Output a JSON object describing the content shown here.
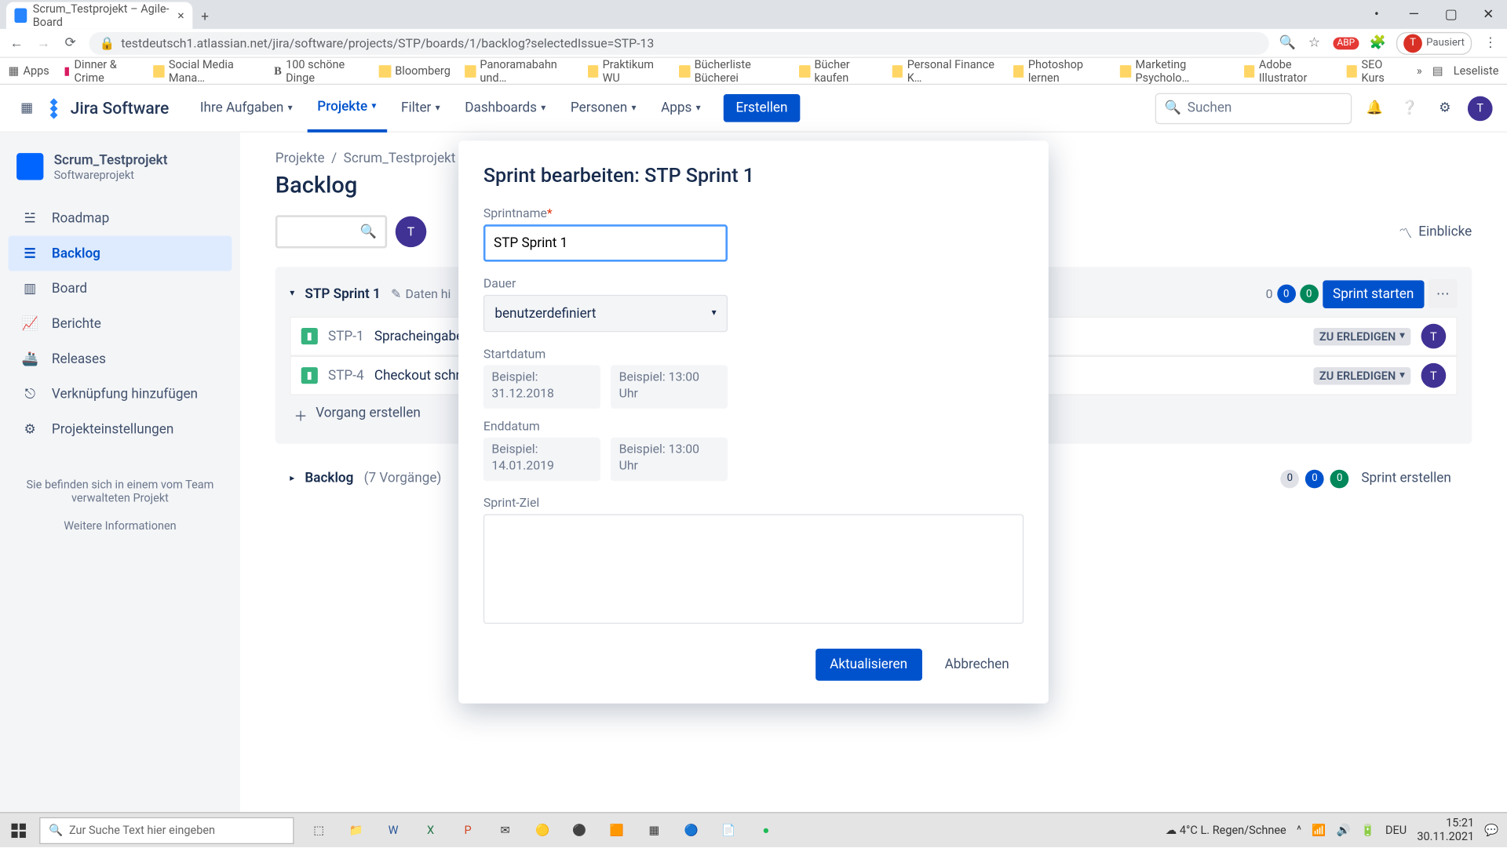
{
  "browser": {
    "tab_title": "Scrum_Testprojekt – Agile-Board",
    "url": "testdeutsch1.atlassian.net/jira/software/projects/STP/boards/1/backlog?selectedIssue=STP-13",
    "paused": "Pausiert",
    "bookmarks": [
      "Apps",
      "Dinner & Crime",
      "Social Media Mana…",
      "100 schöne Dinge",
      "Bloomberg",
      "Panoramabahn und…",
      "Praktikum WU",
      "Bücherliste Bücherei",
      "Bücher kaufen",
      "Personal Finance K…",
      "Photoshop lernen",
      "Marketing Psycholo…",
      "Adobe Illustrator",
      "SEO Kurs"
    ],
    "readlist": "Leseliste"
  },
  "nav": {
    "product": "Jira Software",
    "items": [
      "Ihre Aufgaben",
      "Projekte",
      "Filter",
      "Dashboards",
      "Personen",
      "Apps"
    ],
    "active": 1,
    "create": "Erstellen",
    "search_placeholder": "Suchen"
  },
  "sidebar": {
    "project_name": "Scrum_Testprojekt",
    "project_type": "Softwareprojekt",
    "items": [
      {
        "label": "Roadmap",
        "icon": "roadmap"
      },
      {
        "label": "Backlog",
        "icon": "backlog",
        "active": true
      },
      {
        "label": "Board",
        "icon": "board"
      },
      {
        "label": "Berichte",
        "icon": "reports"
      },
      {
        "label": "Releases",
        "icon": "releases"
      },
      {
        "label": "Verknüpfung hinzufügen",
        "icon": "link"
      },
      {
        "label": "Projekteinstellungen",
        "icon": "settings"
      }
    ],
    "footer1": "Sie befinden sich in einem vom Team verwalteten Projekt",
    "footer2": "Weitere Informationen"
  },
  "page": {
    "crumb_projects": "Projekte",
    "crumb_project": "Scrum_Testprojekt",
    "title": "Backlog",
    "insights": "Einblicke"
  },
  "sprint": {
    "name": "STP Sprint 1",
    "edit": "Daten hi",
    "count": "0",
    "start": "Sprint starten",
    "issues": [
      {
        "key": "STP-1",
        "summary": "Spracheingabe",
        "status": "ZU ERLEDIGEN"
      },
      {
        "key": "STP-4",
        "summary": "Checkout schne",
        "status": "ZU ERLEDIGEN"
      }
    ],
    "create": "Vorgang erstellen"
  },
  "backlog_section": {
    "title": "Backlog",
    "count": "(7 Vorgänge)",
    "create_sprint": "Sprint erstellen"
  },
  "modal": {
    "title": "Sprint bearbeiten: STP Sprint 1",
    "name_label": "Sprintname",
    "name_value": "STP Sprint 1",
    "duration_label": "Dauer",
    "duration_value": "benutzerdefiniert",
    "start_label": "Startdatum",
    "start_date_ph": "Beispiel: 31.12.2018",
    "start_time_ph": "Beispiel: 13:00 Uhr",
    "end_label": "Enddatum",
    "end_date_ph": "Beispiel: 14.01.2019",
    "end_time_ph": "Beispiel: 13:00 Uhr",
    "goal_label": "Sprint-Ziel",
    "update": "Aktualisieren",
    "cancel": "Abbrechen"
  },
  "taskbar": {
    "search_placeholder": "Zur Suche Text hier eingeben",
    "weather": "4°C  L. Regen/Schnee",
    "lang": "DEU",
    "time": "15:21",
    "date": "30.11.2021"
  }
}
